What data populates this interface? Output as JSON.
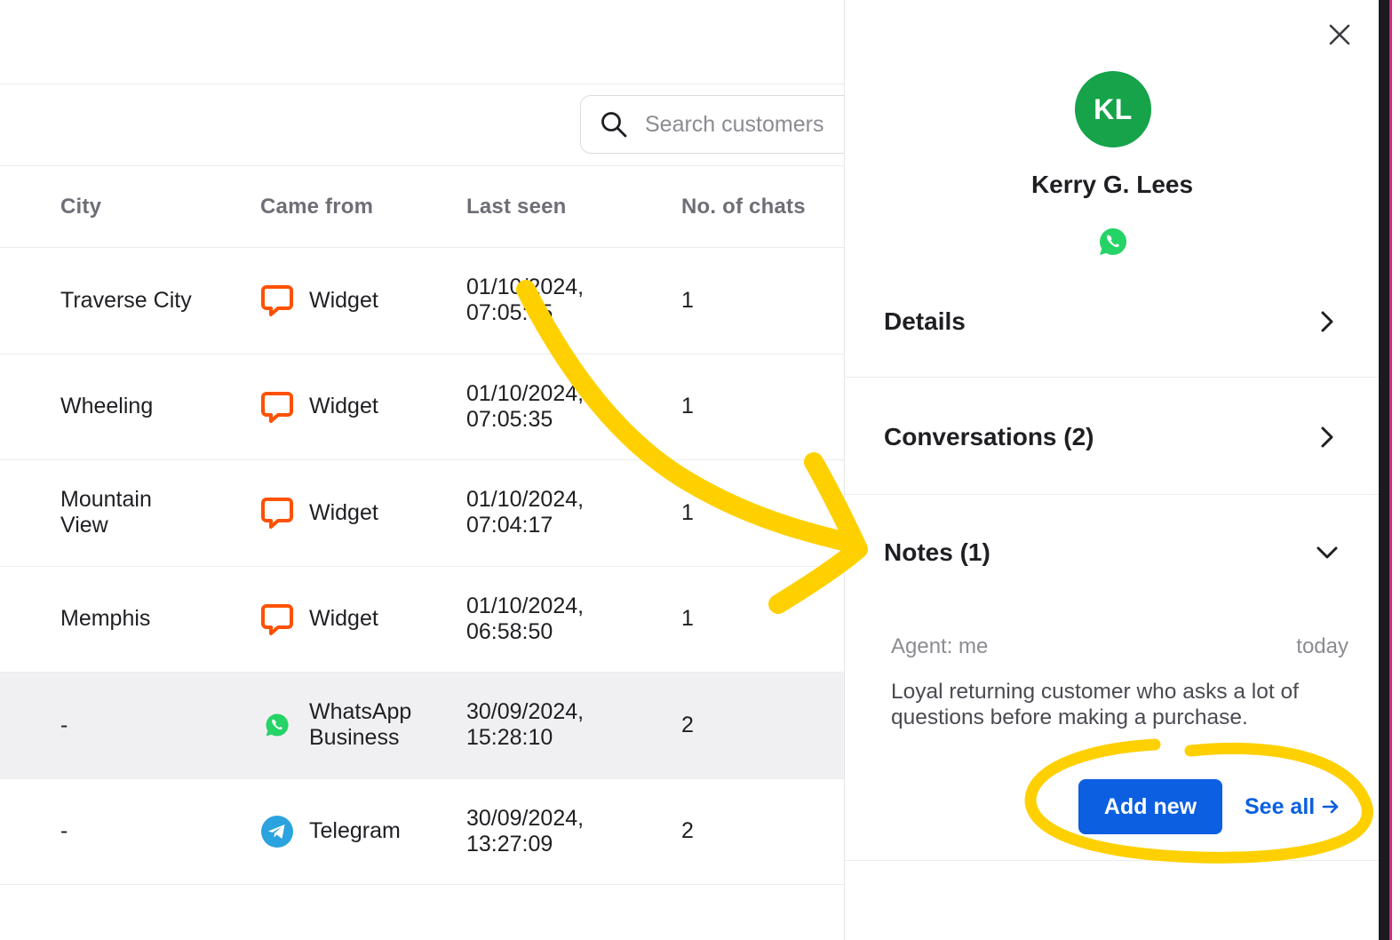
{
  "search": {
    "placeholder": "Search customers"
  },
  "table": {
    "columns": {
      "city": "City",
      "came_from": "Came from",
      "last_seen": "Last seen",
      "chats": "No. of chats"
    },
    "rows": [
      {
        "city": "Traverse City",
        "source": "Widget",
        "source_icon": "livechat-widget-icon",
        "date": "01/10/2024,",
        "time": "07:05:35",
        "chats": "1"
      },
      {
        "city": "Wheeling",
        "source": "Widget",
        "source_icon": "livechat-widget-icon",
        "date": "01/10/2024,",
        "time": "07:05:35",
        "chats": "1"
      },
      {
        "city": "Mountain View",
        "source": "Widget",
        "source_icon": "livechat-widget-icon",
        "date": "01/10/2024,",
        "time": "07:04:17",
        "chats": "1"
      },
      {
        "city": "Memphis",
        "source": "Widget",
        "source_icon": "livechat-widget-icon",
        "date": "01/10/2024,",
        "time": "06:58:50",
        "chats": "1"
      },
      {
        "city": "-",
        "source": "WhatsApp Business",
        "source_icon": "whatsapp-icon",
        "date": "30/09/2024,",
        "time": "15:28:10",
        "chats": "2"
      },
      {
        "city": "-",
        "source": "Telegram",
        "source_icon": "telegram-icon",
        "date": "30/09/2024,",
        "time": "13:27:09",
        "chats": "2"
      }
    ]
  },
  "drawer": {
    "avatar_initials": "KL",
    "customer_name": "Kerry G. Lees",
    "channel_icon": "whatsapp-icon",
    "sections": {
      "details": "Details",
      "conversations": "Conversations (2)",
      "notes": "Notes (1)"
    },
    "note": {
      "agent": "Agent: me",
      "date": "today",
      "text": "Loyal returning customer who asks a lot of questions before making a purchase."
    },
    "add_new_label": "Add new",
    "see_all_label": "See all"
  },
  "colors": {
    "accent_blue": "#0b5fe0",
    "avatar_green": "#16a34a",
    "widget_orange": "#ff5100",
    "whatsapp_green": "#25d366",
    "telegram_blue": "#2aa3df",
    "annotation_yellow": "#ffd000",
    "highlight_row": "#f0f0f2"
  }
}
